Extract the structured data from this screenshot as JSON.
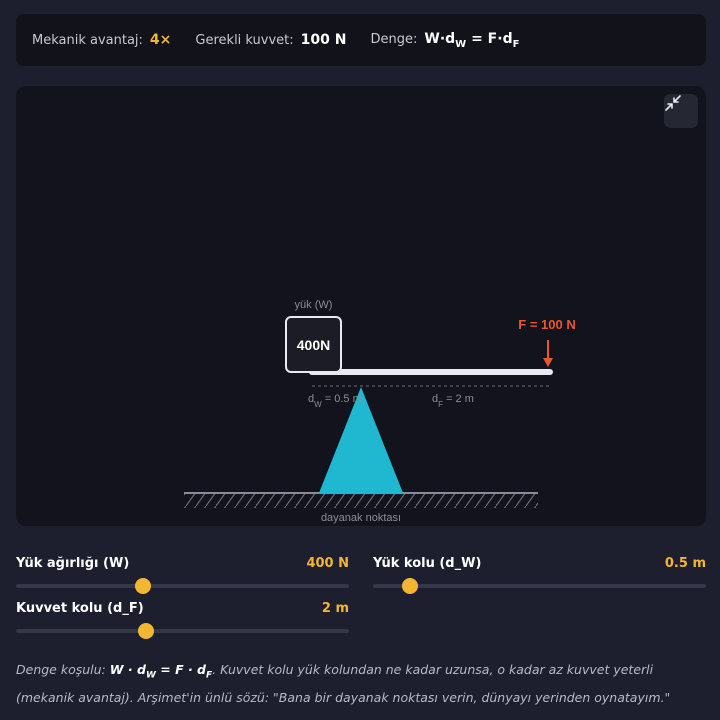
{
  "stats": {
    "mechanical_advantage_label": "Mekanik avantaj:",
    "mechanical_advantage_value": "4×",
    "required_force_label": "Gerekli kuvvet:",
    "required_force_value": "100 N",
    "balance_label": "Denge:",
    "balance_formula": "W·dW = F·dF"
  },
  "diagram": {
    "load_caption": "yük (W)",
    "load_value": "400N",
    "force_label": "F = 100 N",
    "dw_label": "dW = 0.5 m",
    "df_label": "dF = 2 m",
    "fulcrum_label": "dayanak noktası",
    "colors": {
      "fulcrum": "#1fb8d0",
      "force": "#f0542c",
      "beam": "#e9eaf0"
    }
  },
  "controls": {
    "load_weight": {
      "label": "Yük ağırlığı (W)",
      "value": "400 N",
      "fraction": 0.38
    },
    "load_arm": {
      "label": "Yük kolu (d_W)",
      "value": "0.5 m",
      "fraction": 0.11
    },
    "force_arm": {
      "label": "Kuvvet kolu (d_F)",
      "value": "2 m",
      "fraction": 0.39
    }
  },
  "note": {
    "prefix": "Denge koşulu:",
    "formula": "W · dW = F · dF",
    "text": "Kuvvet kolu yük kolundan ne kadar uzunsa, o kadar az kuvvet yeterli (mekanik avantaj). Arşimet'in ünlü sözü: \"Bana bir dayanak noktası verin, dünyayı yerinden oynatayım.\""
  },
  "icons": {
    "collapse": "collapse-arrows-icon"
  }
}
